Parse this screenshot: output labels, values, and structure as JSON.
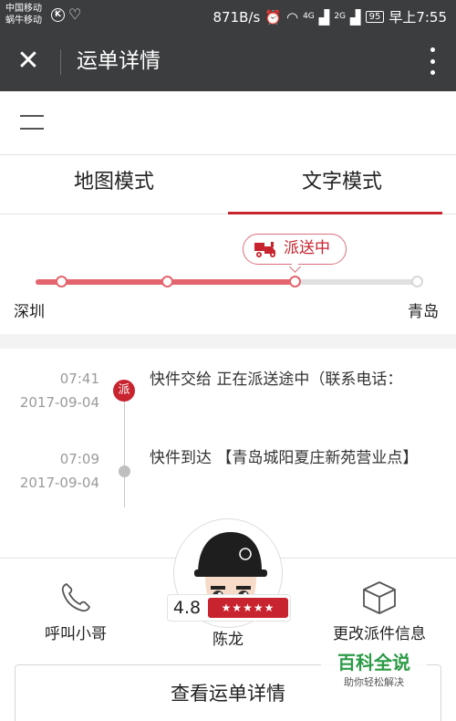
{
  "status_bar": {
    "carrier1": "中国移动",
    "carrier2": "蜗牛移动",
    "speed": "871B/s",
    "net1": "4G",
    "net2": "2G",
    "battery": "95",
    "time": "早上7:55"
  },
  "header": {
    "title": "运单详情"
  },
  "tabs": [
    {
      "label": "地图模式",
      "active": false
    },
    {
      "label": "文字模式",
      "active": true
    }
  ],
  "progress": {
    "status_label": "派送中",
    "origin": "深圳",
    "destination": "青岛",
    "completed_fraction": 0.68
  },
  "timeline": [
    {
      "time": "07:41",
      "date": "2017-09-04",
      "badge": "派",
      "text": "快件交给          正在派送途中（联系电话："
    },
    {
      "time": "07:09",
      "date": "2017-09-04",
      "text": "快件到达 【青岛城阳夏庄新苑营业点】"
    }
  ],
  "courier": {
    "name": "陈龙",
    "rating": "4.8",
    "stars": "★★★★★"
  },
  "actions": {
    "call": "呼叫小哥",
    "change": "更改派件信息"
  },
  "detail_button": "查看运单详情",
  "watermark": {
    "title": "百科全说",
    "subtitle": "助你轻松解决"
  },
  "colors": {
    "accent": "#c8242f",
    "track": "#e4656d",
    "header": "#3c3d3f"
  }
}
